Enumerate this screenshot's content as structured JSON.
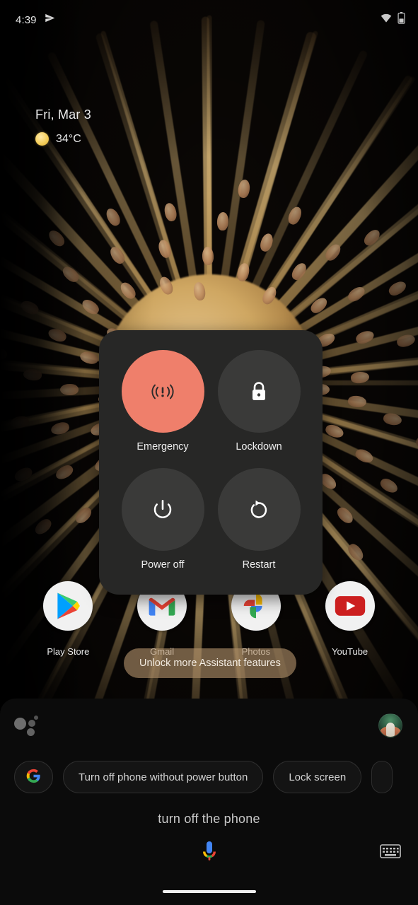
{
  "status_bar": {
    "time": "4:39",
    "icons": [
      "send-icon",
      "wifi-icon",
      "battery-icon"
    ]
  },
  "glance_widget": {
    "date": "Fri, Mar 3",
    "weather_icon": "sun-icon",
    "temperature": "34°C"
  },
  "power_dialog": {
    "buttons": [
      {
        "label": "Emergency",
        "icon": "emergency-broadcast-icon",
        "color": "#ef7f6b"
      },
      {
        "label": "Lockdown",
        "icon": "lock-icon",
        "color": "#3a3a39"
      },
      {
        "label": "Power off",
        "icon": "power-icon",
        "color": "#3a3a39"
      },
      {
        "label": "Restart",
        "icon": "restart-icon",
        "color": "#3a3a39"
      }
    ],
    "background_color": "#272726"
  },
  "dock": {
    "apps": [
      {
        "label": "Play Store",
        "icon": "play-store-icon"
      },
      {
        "label": "Gmail",
        "icon": "gmail-icon"
      },
      {
        "label": "Photos",
        "icon": "google-photos-icon"
      },
      {
        "label": "YouTube",
        "icon": "youtube-icon"
      }
    ]
  },
  "assistant_hint": {
    "text": "Unlock more Assistant features"
  },
  "assistant": {
    "logo_icon": "assistant-dots-icon",
    "avatar_icon": "user-avatar",
    "chips": [
      {
        "label": "",
        "icon": "google-g-icon"
      },
      {
        "label": "Turn off phone without power button",
        "icon": ""
      },
      {
        "label": "Lock screen",
        "icon": ""
      },
      {
        "label": "",
        "icon": ""
      }
    ],
    "transcript": "turn off the phone",
    "mic_icon": "google-mic-icon",
    "keyboard_icon": "keyboard-icon"
  },
  "navigation": {
    "home_indicator": "home-indicator"
  }
}
